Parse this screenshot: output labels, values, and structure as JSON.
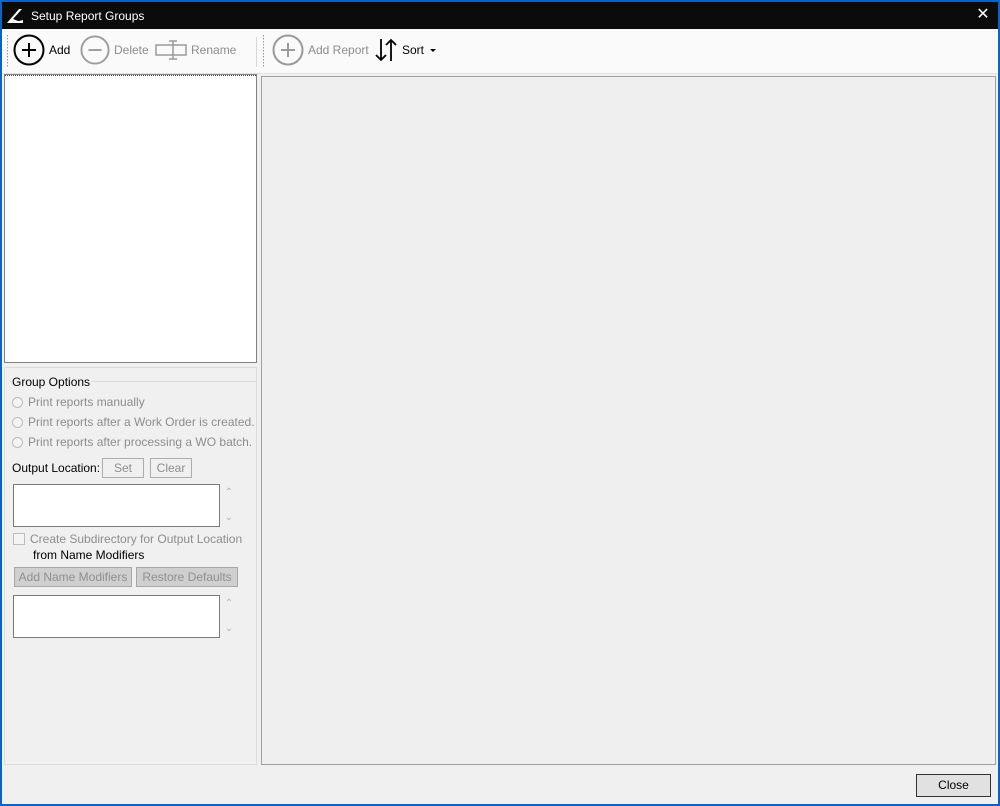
{
  "window": {
    "title": "Setup Report Groups",
    "close_glyph": "✕"
  },
  "toolbar": {
    "add_label": "Add",
    "delete_label": "Delete",
    "rename_label": "Rename",
    "add_report_label": "Add Report",
    "sort_label": "Sort"
  },
  "group_options": {
    "legend": "Group Options",
    "radios": [
      "Print reports manually",
      "Print reports after a Work Order is created.",
      "Print reports after processing a WO batch."
    ],
    "output_location_label": "Output Location:",
    "set_label": "Set",
    "clear_label": "Clear",
    "subdir_line1": "Create Subdirectory for Output Location",
    "subdir_line2": "from Name Modifiers",
    "add_name_modifiers_label": "Add Name Modifiers",
    "restore_defaults_label": "Restore Defaults",
    "output_location_value": "",
    "name_modifiers_value": ""
  },
  "footer": {
    "close_label": "Close"
  },
  "colors": {
    "titlebar": "#0b0b0b",
    "border_accent": "#0a63c9",
    "disabled_text": "#8d8d8d"
  }
}
